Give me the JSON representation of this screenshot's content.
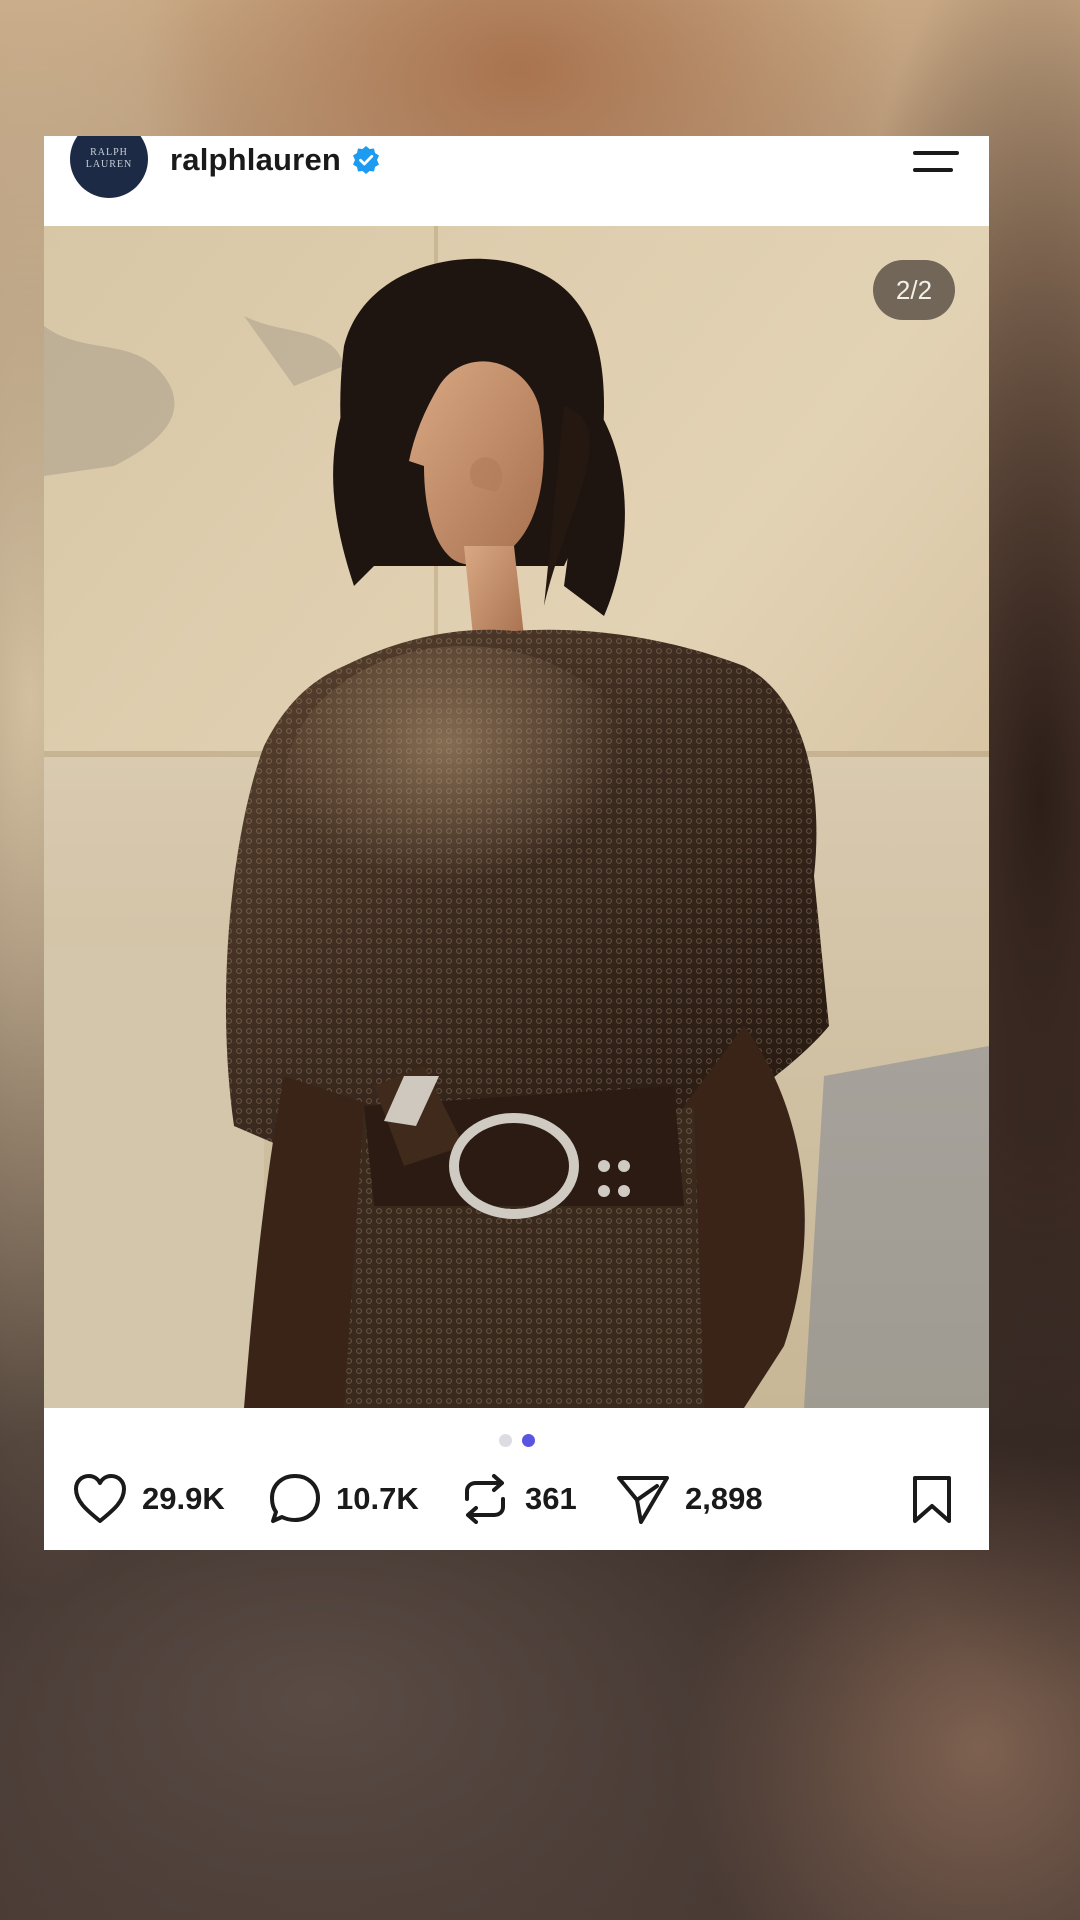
{
  "post": {
    "username": "ralphlauren",
    "avatar_text_line1": "RALPH",
    "avatar_text_line2": "LAUREN",
    "verified": true,
    "image_counter": "2/2",
    "carousel": {
      "total": 2,
      "active_index": 2
    }
  },
  "actions": {
    "likes": "29.9K",
    "comments": "10.7K",
    "reposts": "361",
    "shares": "2,898"
  },
  "icons": {
    "menu": "menu-icon",
    "verified": "verified-badge-icon",
    "like": "heart-icon",
    "comment": "comment-bubble-icon",
    "repost": "repost-icon",
    "share": "send-icon",
    "save": "bookmark-icon"
  },
  "colors": {
    "verified_blue": "#1d9bf0",
    "active_dot": "#5a55e0",
    "inactive_dot": "#dcdce2",
    "text": "#1a1a1a"
  }
}
